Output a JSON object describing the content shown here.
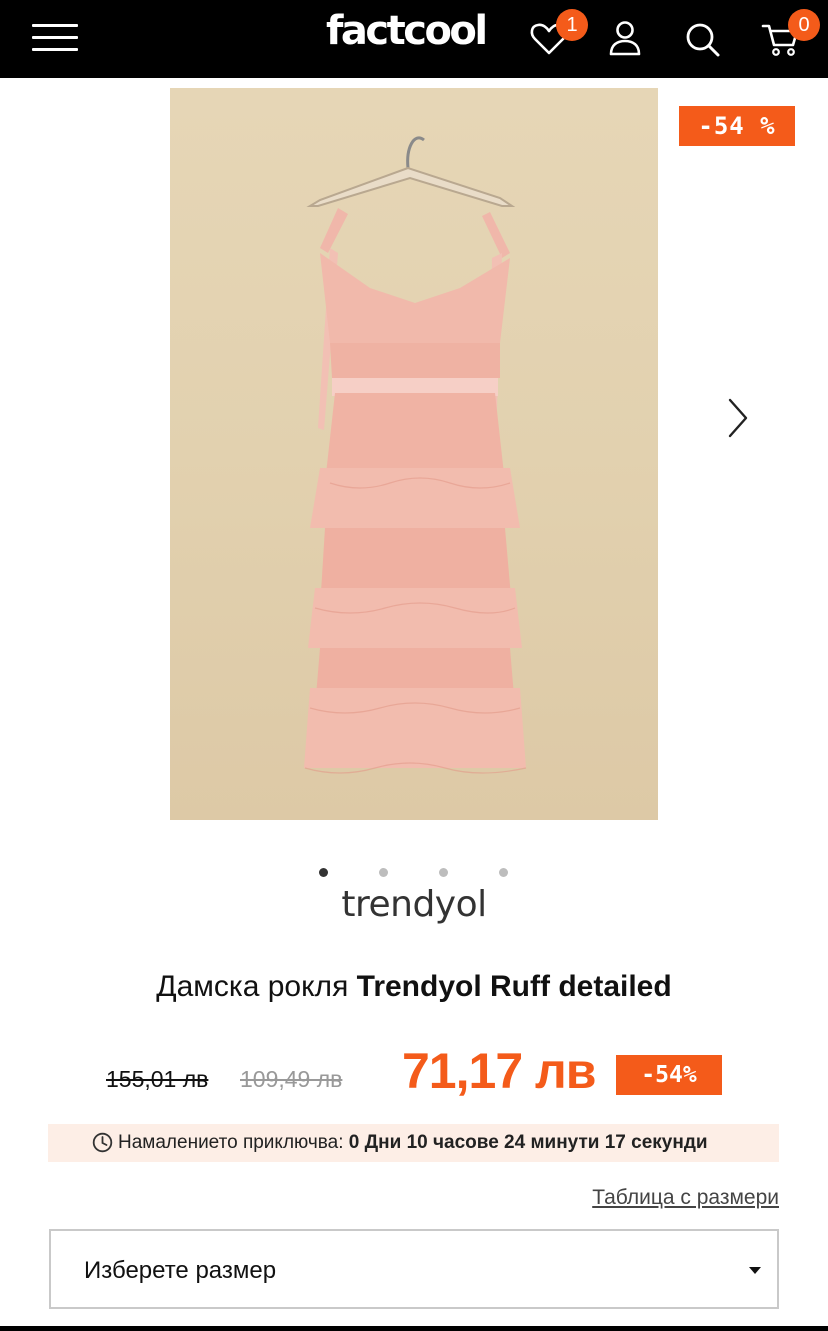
{
  "header": {
    "logo_text": "factcool",
    "wishlist_count": "1",
    "cart_count": "0",
    "icons": [
      "menu-icon",
      "heart-icon",
      "user-icon",
      "search-icon",
      "cart-icon"
    ],
    "accent_color": "#f45b1a",
    "background_color": "#000000"
  },
  "product": {
    "badge_discount": "-54 %",
    "gallery": {
      "slide_count": 4,
      "active_slide": 1
    },
    "brand": "trendyol",
    "title_prefix": "Дамска рокля ",
    "title_bold": "Trendyol Ruff detailed",
    "old_price_1": "155,01 лв",
    "old_price_2": "109,49 лв",
    "new_price": "71,17 лв",
    "discount_label": "-54%",
    "timer": {
      "label": "Намалението приключва:",
      "value": "0 Дни 10 часове 24 минути 17 секунди"
    },
    "size_table_link": "Таблица с размери",
    "size_select_placeholder": "Изберете размер"
  }
}
